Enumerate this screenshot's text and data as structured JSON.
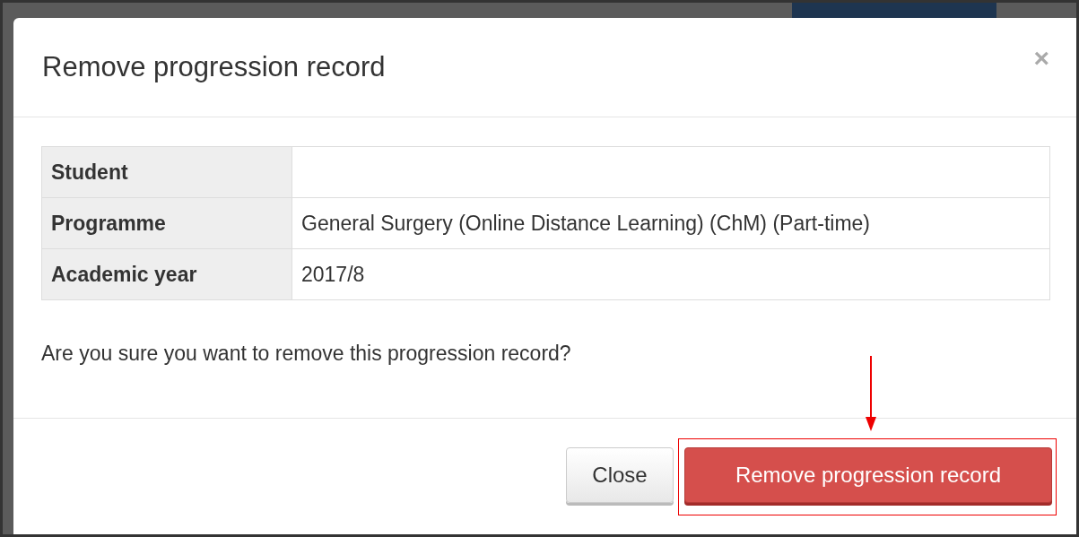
{
  "dialog": {
    "title": "Remove progression record",
    "close_icon": "×",
    "details": [
      {
        "label": "Student"
      },
      {
        "label": "Programme",
        "value": "General Surgery (Online Distance Learning) (ChM) (Part-time)"
      },
      {
        "label": "Academic year",
        "value": "2017/8"
      }
    ],
    "question": "Are you sure you want to remove this progression record?",
    "buttons": [
      {
        "label": "Close",
        "kind": "default"
      },
      {
        "label": "Remove progression record",
        "kind": "danger"
      }
    ]
  }
}
